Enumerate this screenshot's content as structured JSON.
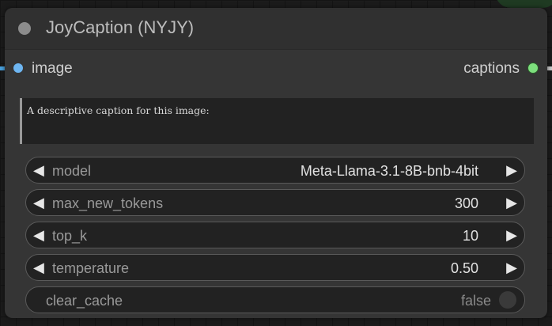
{
  "node": {
    "title": "JoyCaption (NYJY)",
    "inputs": [
      {
        "label": "image",
        "color": "#6eb6f2"
      }
    ],
    "outputs": [
      {
        "label": "captions",
        "color": "#7ddf7d"
      }
    ],
    "prompt_text": "A descriptive caption for this image:",
    "widgets": [
      {
        "label": "model",
        "value": "Meta-Llama-3.1-8B-bnb-4bit"
      },
      {
        "label": "max_new_tokens",
        "value": "300"
      },
      {
        "label": "top_k",
        "value": "10"
      },
      {
        "label": "temperature",
        "value": "0.50"
      }
    ],
    "toggle": {
      "label": "clear_cache",
      "value": "false"
    },
    "arrows": {
      "left": "◀",
      "right": "▶"
    }
  },
  "icons": {
    "collapse": "collapse-dot-icon",
    "input_slot": "input-slot-dot-icon",
    "output_slot": "output-slot-dot-icon",
    "decrement": "left-arrow-icon",
    "increment": "right-arrow-icon"
  },
  "colors": {
    "node_bg": "#353535",
    "canvas_bg": "#1b1b1b",
    "link_input": "#4aa3e0",
    "link_output": "#c8c8c8"
  }
}
